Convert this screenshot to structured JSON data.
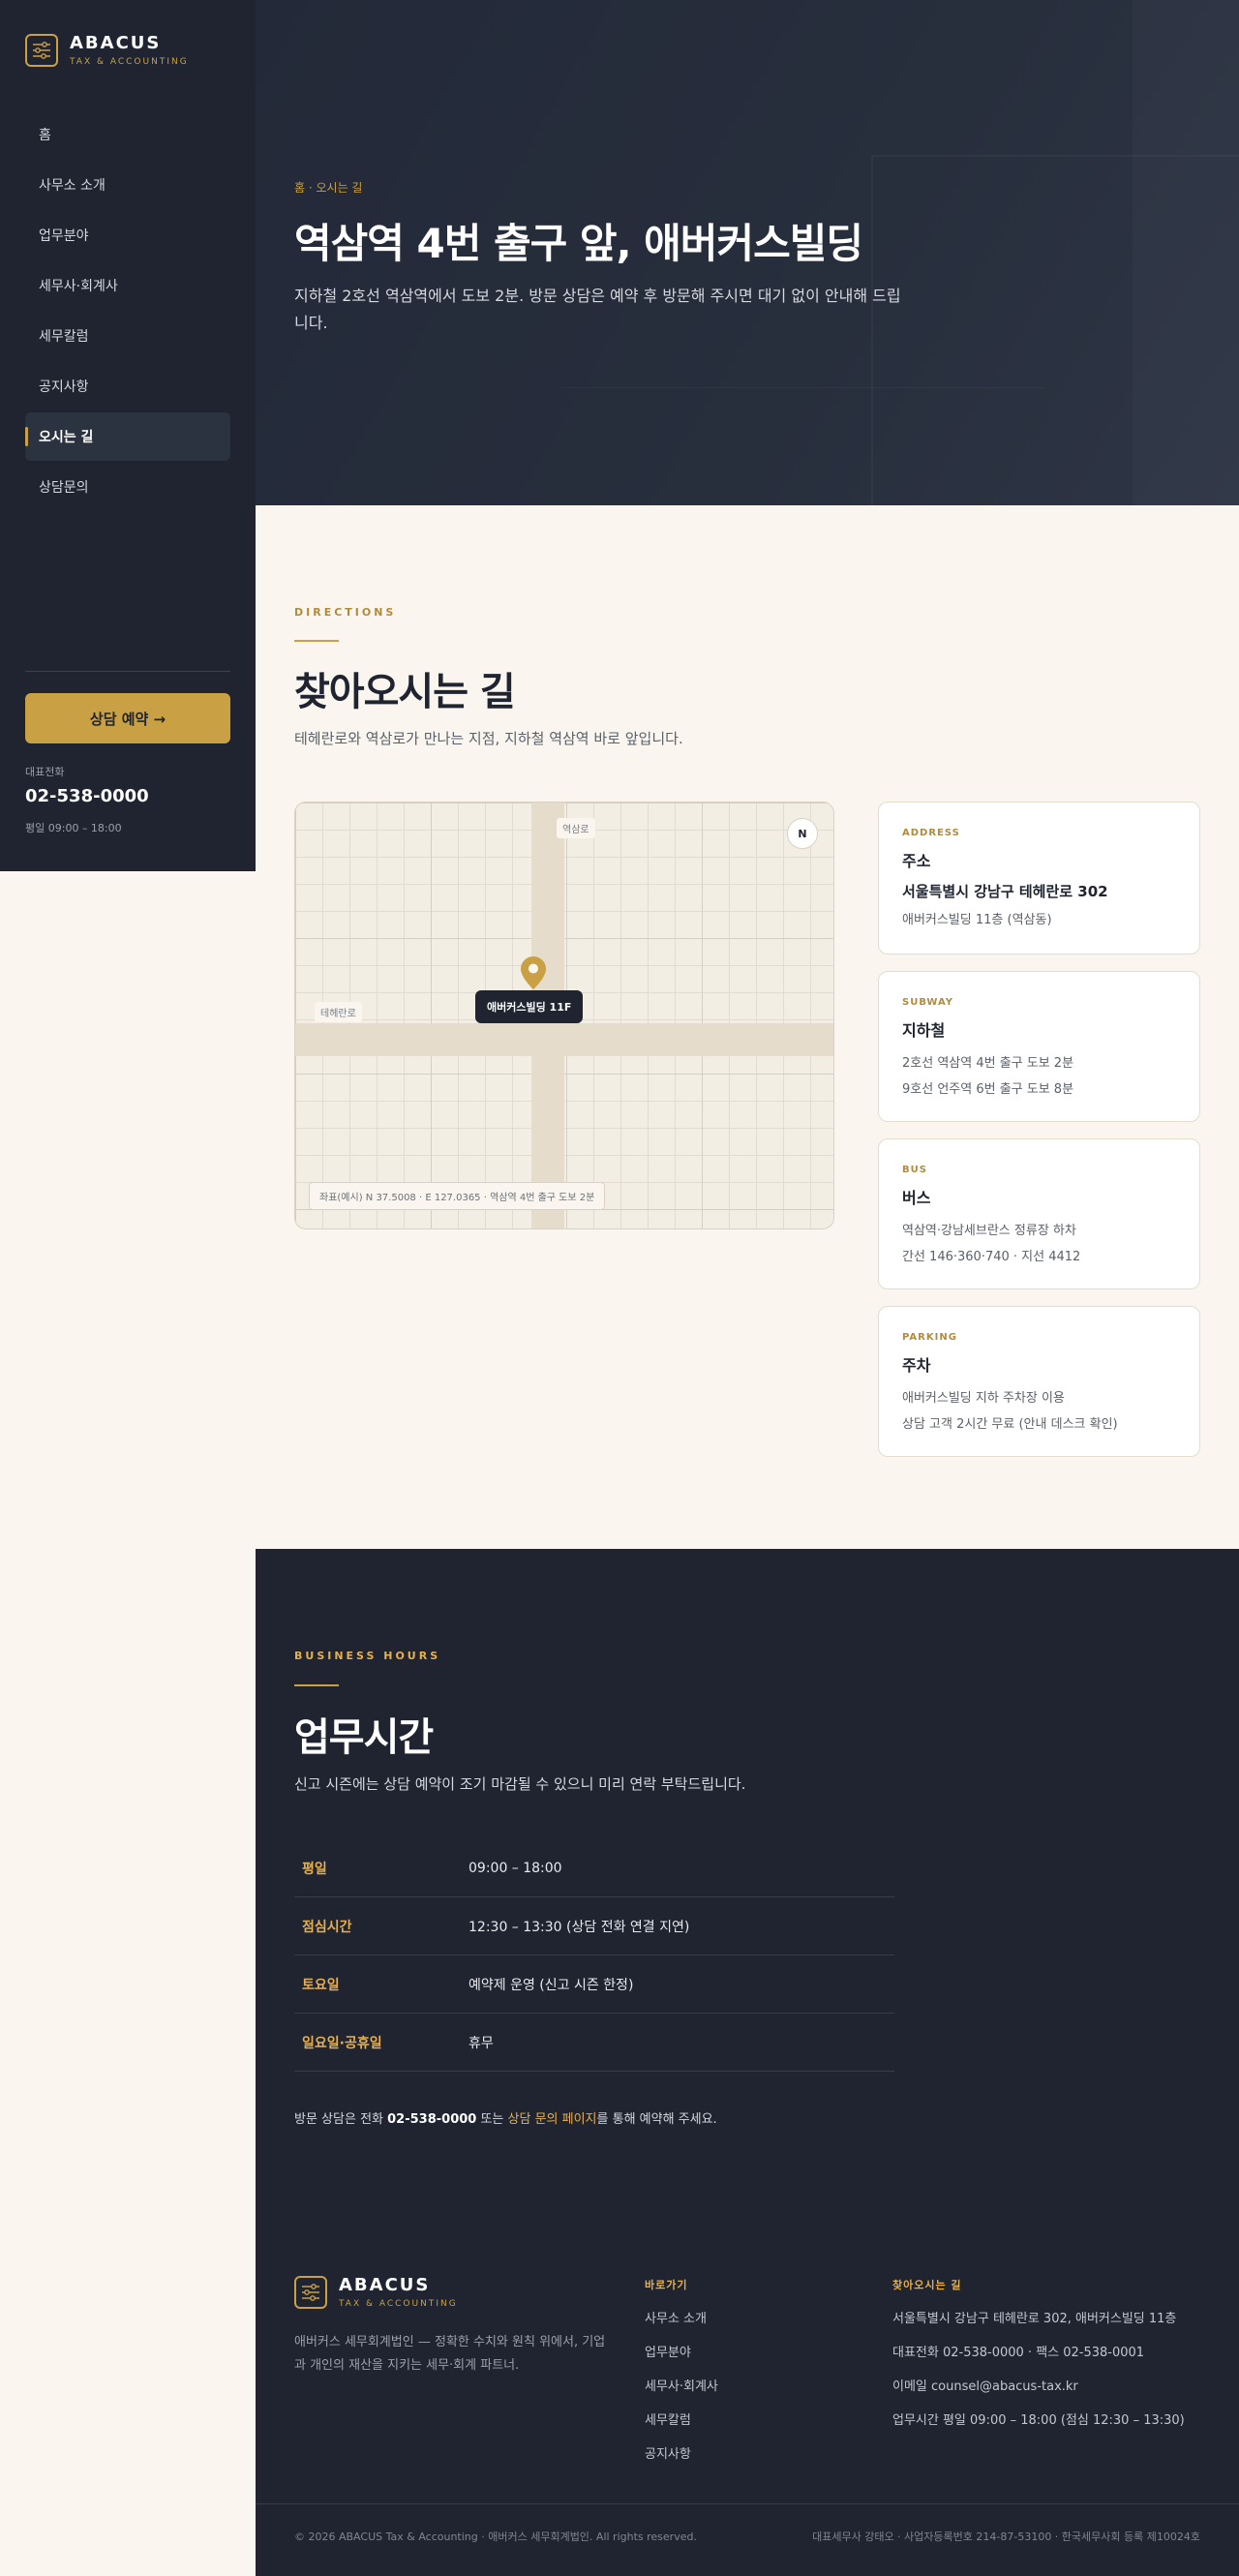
{
  "brand": {
    "name": "ABACUS",
    "sub": "TAX & ACCOUNTING"
  },
  "nav": {
    "items": [
      {
        "label": "홈"
      },
      {
        "label": "사무소 소개"
      },
      {
        "label": "업무분야"
      },
      {
        "label": "세무사·회계사"
      },
      {
        "label": "세무칼럼"
      },
      {
        "label": "공지사항"
      },
      {
        "label": "오시는 길"
      },
      {
        "label": "상담문의"
      }
    ],
    "active_index": 6
  },
  "sidebar": {
    "cta_label": "상담 예약 →",
    "phone_label": "대표전화",
    "phone": "02-538-0000",
    "hours": "평일 09:00 – 18:00"
  },
  "hero": {
    "breadcrumb": "홈 · 오시는 길",
    "title": "역삼역 4번 출구 앞, 애버커스빌딩",
    "desc": "지하철 2호선 역삼역에서 도보 2분. 방문 상담은 예약 후 방문해 주시면 대기 없이 안내해 드립니다."
  },
  "directions": {
    "eyebrow": "DIRECTIONS",
    "title": "찾아오시는 길",
    "desc": "테헤란로와 역삼로가 만나는 지점, 지하철 역삼역 바로 앞입니다.",
    "map": {
      "road_v": "역삼로",
      "road_h": "테헤란로",
      "compass": "N",
      "tag": "애버커스빌딩 11F",
      "coords": "좌표(예시) N 37.5008 · E 127.0365 · 역삼역 4번 출구 도보 2분"
    },
    "cards": [
      {
        "eyebrow": "ADDRESS",
        "title": "주소",
        "line1": "서울특별시 강남구 테헤란로 302",
        "line2": "애버커스빌딩 11층 (역삼동)"
      },
      {
        "eyebrow": "SUBWAY",
        "title": "지하철",
        "line1": "2호선 역삼역 4번 출구 도보 2분",
        "line2": "9호선 언주역 6번 출구 도보 8분"
      },
      {
        "eyebrow": "BUS",
        "title": "버스",
        "line1": "역삼역·강남세브란스 정류장 하차",
        "line2": "간선 146·360·740 · 지선 4412"
      },
      {
        "eyebrow": "PARKING",
        "title": "주차",
        "line1": "애버커스빌딩 지하 주차장 이용",
        "line2": "상담 고객 2시간 무료 (안내 데스크 확인)"
      }
    ]
  },
  "hours": {
    "eyebrow": "BUSINESS HOURS",
    "title": "업무시간",
    "desc": "신고 시즌에는 상담 예약이 조기 마감될 수 있으니 미리 연락 부탁드립니다.",
    "rows": [
      {
        "day": "평일",
        "time": "09:00 – 18:00"
      },
      {
        "day": "점심시간",
        "time": "12:30 – 13:30 (상담 전화 연결 지연)"
      },
      {
        "day": "토요일",
        "time": "예약제 운영 (신고 시즌 한정)"
      },
      {
        "day": "일요일·공휴일",
        "time": "휴무"
      }
    ],
    "note_pre": "방문 상담은 전화 ",
    "note_phone": "02-538-0000",
    "note_mid": " 또는 ",
    "note_link": "상담 문의 페이지",
    "note_post": "를 통해 예약해 주세요."
  },
  "footer": {
    "desc": "애버커스 세무회계법인 — 정확한 수치와 원칙 위에서, 기업과 개인의 재산을 지키는 세무·회계 파트너.",
    "links_title": "바로가기",
    "links": [
      "사무소 소개",
      "업무분야",
      "세무사·회계사",
      "세무칼럼",
      "공지사항"
    ],
    "contact_title": "찾아오시는 길",
    "contact": [
      "서울특별시 강남구 테헤란로 302, 애버커스빌딩 11층",
      "대표전화 02-538-0000 · 팩스 02-538-0001",
      "이메일 counsel@abacus-tax.kr",
      "업무시간 평일 09:00 – 18:00 (점심 12:30 – 13:30)"
    ],
    "copyright": "© 2026 ABACUS Tax & Accounting · 애버커스 세무회계법인. All rights reserved.",
    "registration": "대표세무사 강태오 · 사업자등록번호 214-87-53100 · 한국세무사회 등록 제10024호"
  },
  "colors": {
    "navy": "#1f2430",
    "gold": "#c9a043",
    "cream": "#faf6ef"
  }
}
